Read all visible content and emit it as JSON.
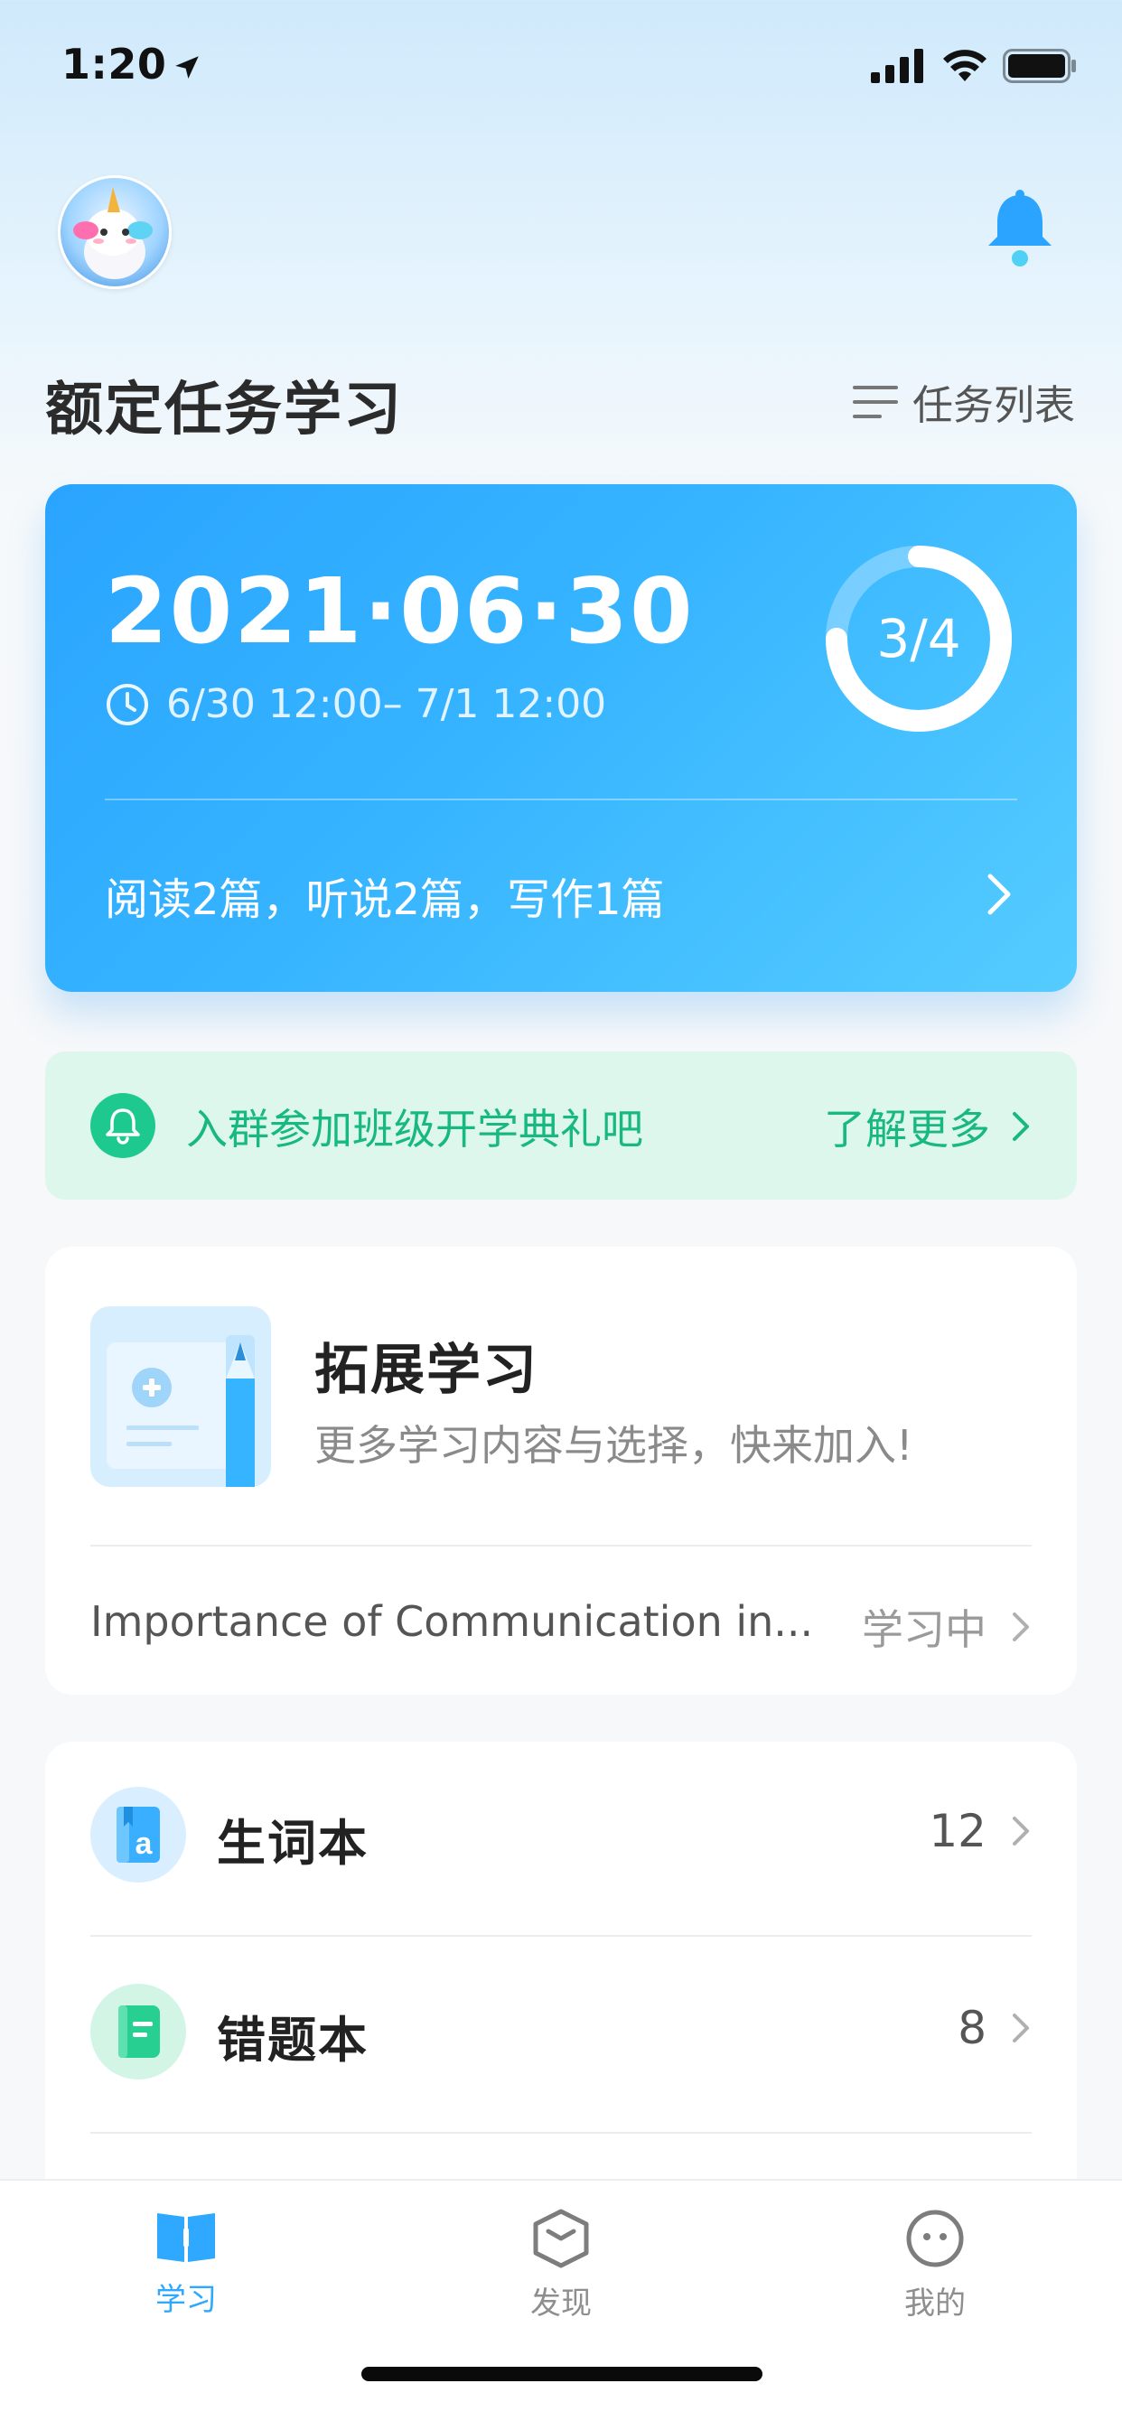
{
  "status_bar": {
    "time": "1:20"
  },
  "header": {
    "title": "额定任务学习",
    "task_list_label": "任务列表"
  },
  "task_card": {
    "date": "2021·06·30",
    "time_range": "6/30 12:00– 7/1 12:00",
    "progress_text": "3/4",
    "progress_fraction": 0.75,
    "summary": "阅读2篇，听说2篇，写作1篇"
  },
  "banner": {
    "text": "入群参加班级开学典礼吧",
    "more_label": "了解更多"
  },
  "extended": {
    "title": "拓展学习",
    "subtitle": "更多学习内容与选择，快来加入!",
    "item_title": "Importance of Communication in...",
    "item_status": "学习中"
  },
  "list": [
    {
      "label": "生词本",
      "count": "12",
      "icon": "vocabulary-book-icon"
    },
    {
      "label": "错题本",
      "count": "8",
      "icon": "mistake-book-icon"
    }
  ],
  "tabs": [
    {
      "label": "学习",
      "icon": "book-icon",
      "active": true
    },
    {
      "label": "发现",
      "icon": "discover-icon",
      "active": false
    },
    {
      "label": "我的",
      "icon": "profile-face-icon",
      "active": false
    }
  ],
  "colors": {
    "accent_blue": "#2fa8ff",
    "accent_green": "#1ec98f",
    "tab_active": "#2fa8ff",
    "tab_inactive": "#8e8e8e"
  }
}
